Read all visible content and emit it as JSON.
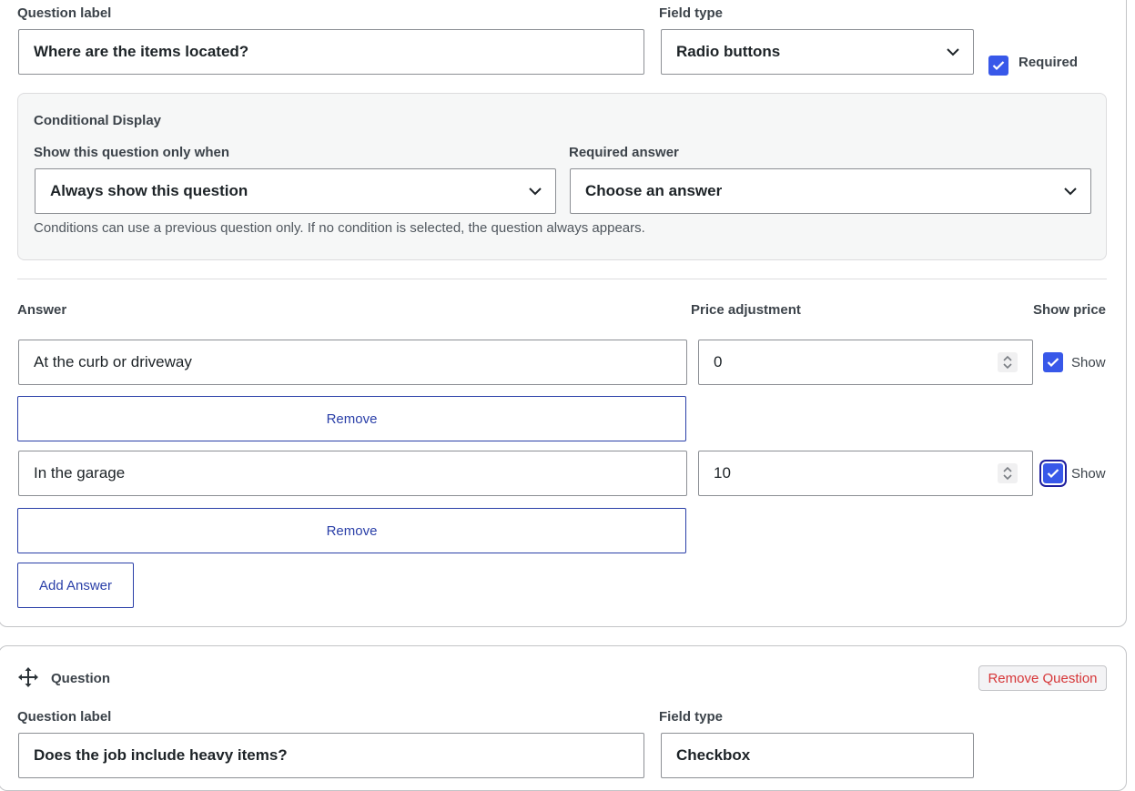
{
  "question_editor": {
    "question_label_title": "Question label",
    "question_label_value": "Where are the items located?",
    "field_type_title": "Field type",
    "field_type_value": "Radio buttons",
    "required_label": "Required",
    "required_checked": true
  },
  "conditional": {
    "title": "Conditional Display",
    "show_when_label": "Show this question only when",
    "show_when_value": "Always show this question",
    "required_answer_label": "Required answer",
    "required_answer_value": "Choose an answer",
    "hint": "Conditions can use a previous question only. If no condition is selected, the question always appears."
  },
  "answers": {
    "col_answer": "Answer",
    "col_price": "Price adjustment",
    "col_show": "Show price",
    "remove_label": "Remove",
    "show_label": "Show",
    "add_label": "Add Answer",
    "items": [
      {
        "answer": "At the curb or driveway",
        "price": "0",
        "show": true
      },
      {
        "answer": "In the garage",
        "price": "10",
        "show": true
      }
    ]
  },
  "next_question": {
    "title": "Question",
    "remove_label": "Remove Question",
    "question_label_title": "Question label",
    "question_label_value": "Does the job include heavy items?",
    "field_type_title": "Field type",
    "field_type_value": "Checkbox"
  },
  "icons": {
    "dropdown": "chevron-down-icon",
    "check": "checkmark-icon",
    "spinner": "number-spinner-icon",
    "drag": "drag-move-icon"
  },
  "colors": {
    "accent": "#3858e9",
    "link": "#2a3fa8",
    "danger": "#d63638"
  }
}
